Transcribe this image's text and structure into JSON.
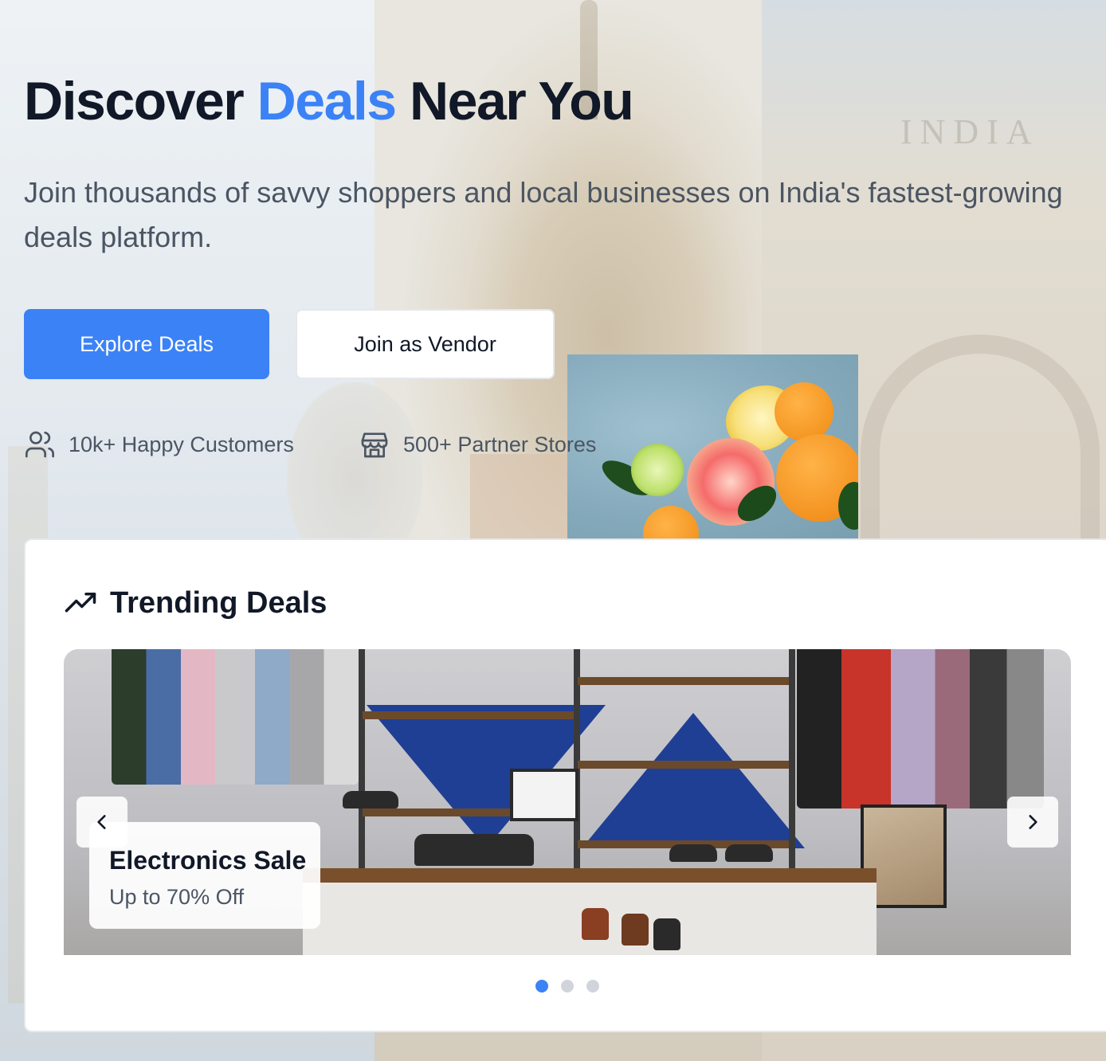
{
  "hero": {
    "title_pre": "Discover ",
    "title_accent": "Deals",
    "title_post": " Near You",
    "subtitle": "Join thousands of savvy shoppers and local businesses on India's fastest-growing deals platform.",
    "explore_label": "Explore Deals",
    "vendor_label": "Join as Vendor",
    "stats": [
      {
        "icon": "users-icon",
        "label": "10k+ Happy Customers"
      },
      {
        "icon": "store-icon",
        "label": "500+ Partner Stores"
      }
    ]
  },
  "background": {
    "gate_inscription": "INDIA"
  },
  "trending": {
    "icon": "trending-up-icon",
    "title": "Trending Deals",
    "slides": [
      {
        "title": "Electronics Sale",
        "subtitle": "Up to 70% Off"
      }
    ],
    "dots": [
      {
        "active": true
      },
      {
        "active": false
      },
      {
        "active": false
      }
    ]
  },
  "colors": {
    "accent": "#3b82f6",
    "text": "#111827",
    "muted": "#4b5563"
  }
}
